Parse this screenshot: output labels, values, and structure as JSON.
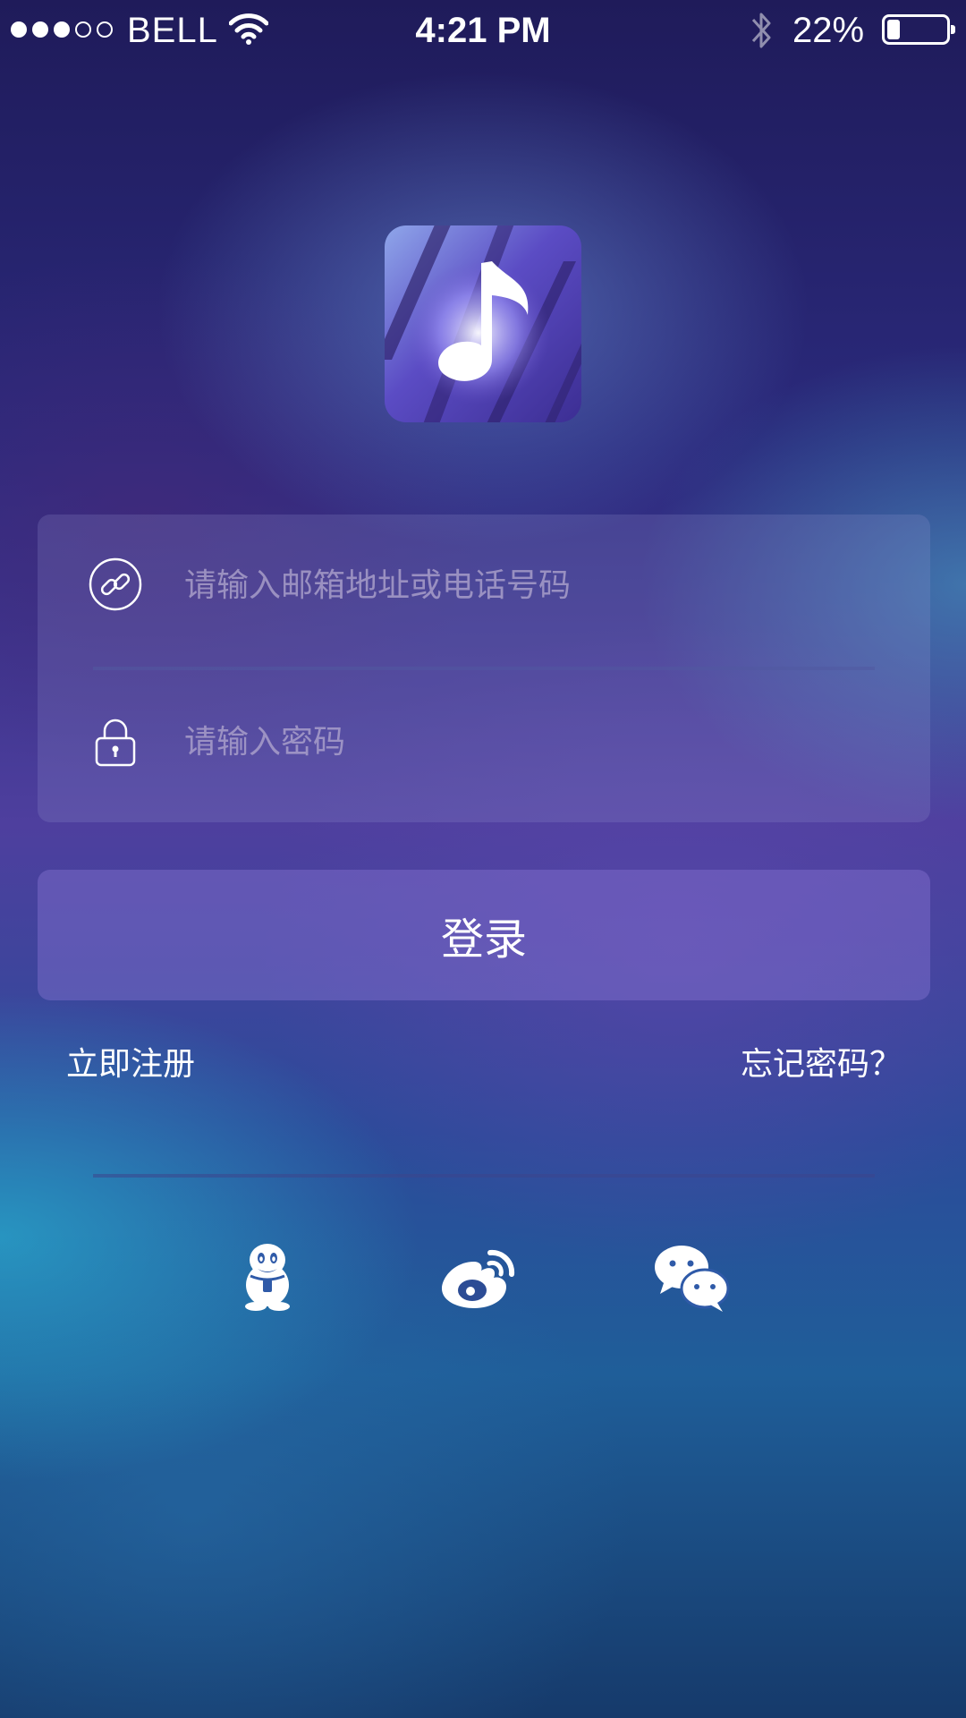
{
  "status_bar": {
    "signal": {
      "filled": 3,
      "total": 5
    },
    "carrier": "BELL",
    "time": "4:21 PM",
    "battery": {
      "percent_label": "22%",
      "level": 0.22
    }
  },
  "form": {
    "email": {
      "placeholder": "请输入邮箱地址或电话号码",
      "value": ""
    },
    "password": {
      "placeholder": "请输入密码",
      "value": ""
    }
  },
  "login_label": "登录",
  "links": {
    "register": "立即注册",
    "forgot": "忘记密码？"
  },
  "social_logins": [
    {
      "name": "qq",
      "icon": "qq-icon"
    },
    {
      "name": "weibo",
      "icon": "weibo-icon"
    },
    {
      "name": "wechat",
      "icon": "wechat-icon"
    }
  ],
  "colors": {
    "accent": "#6a55c8",
    "logo_primary": "#5b4cc4",
    "text": "#ffffff"
  }
}
